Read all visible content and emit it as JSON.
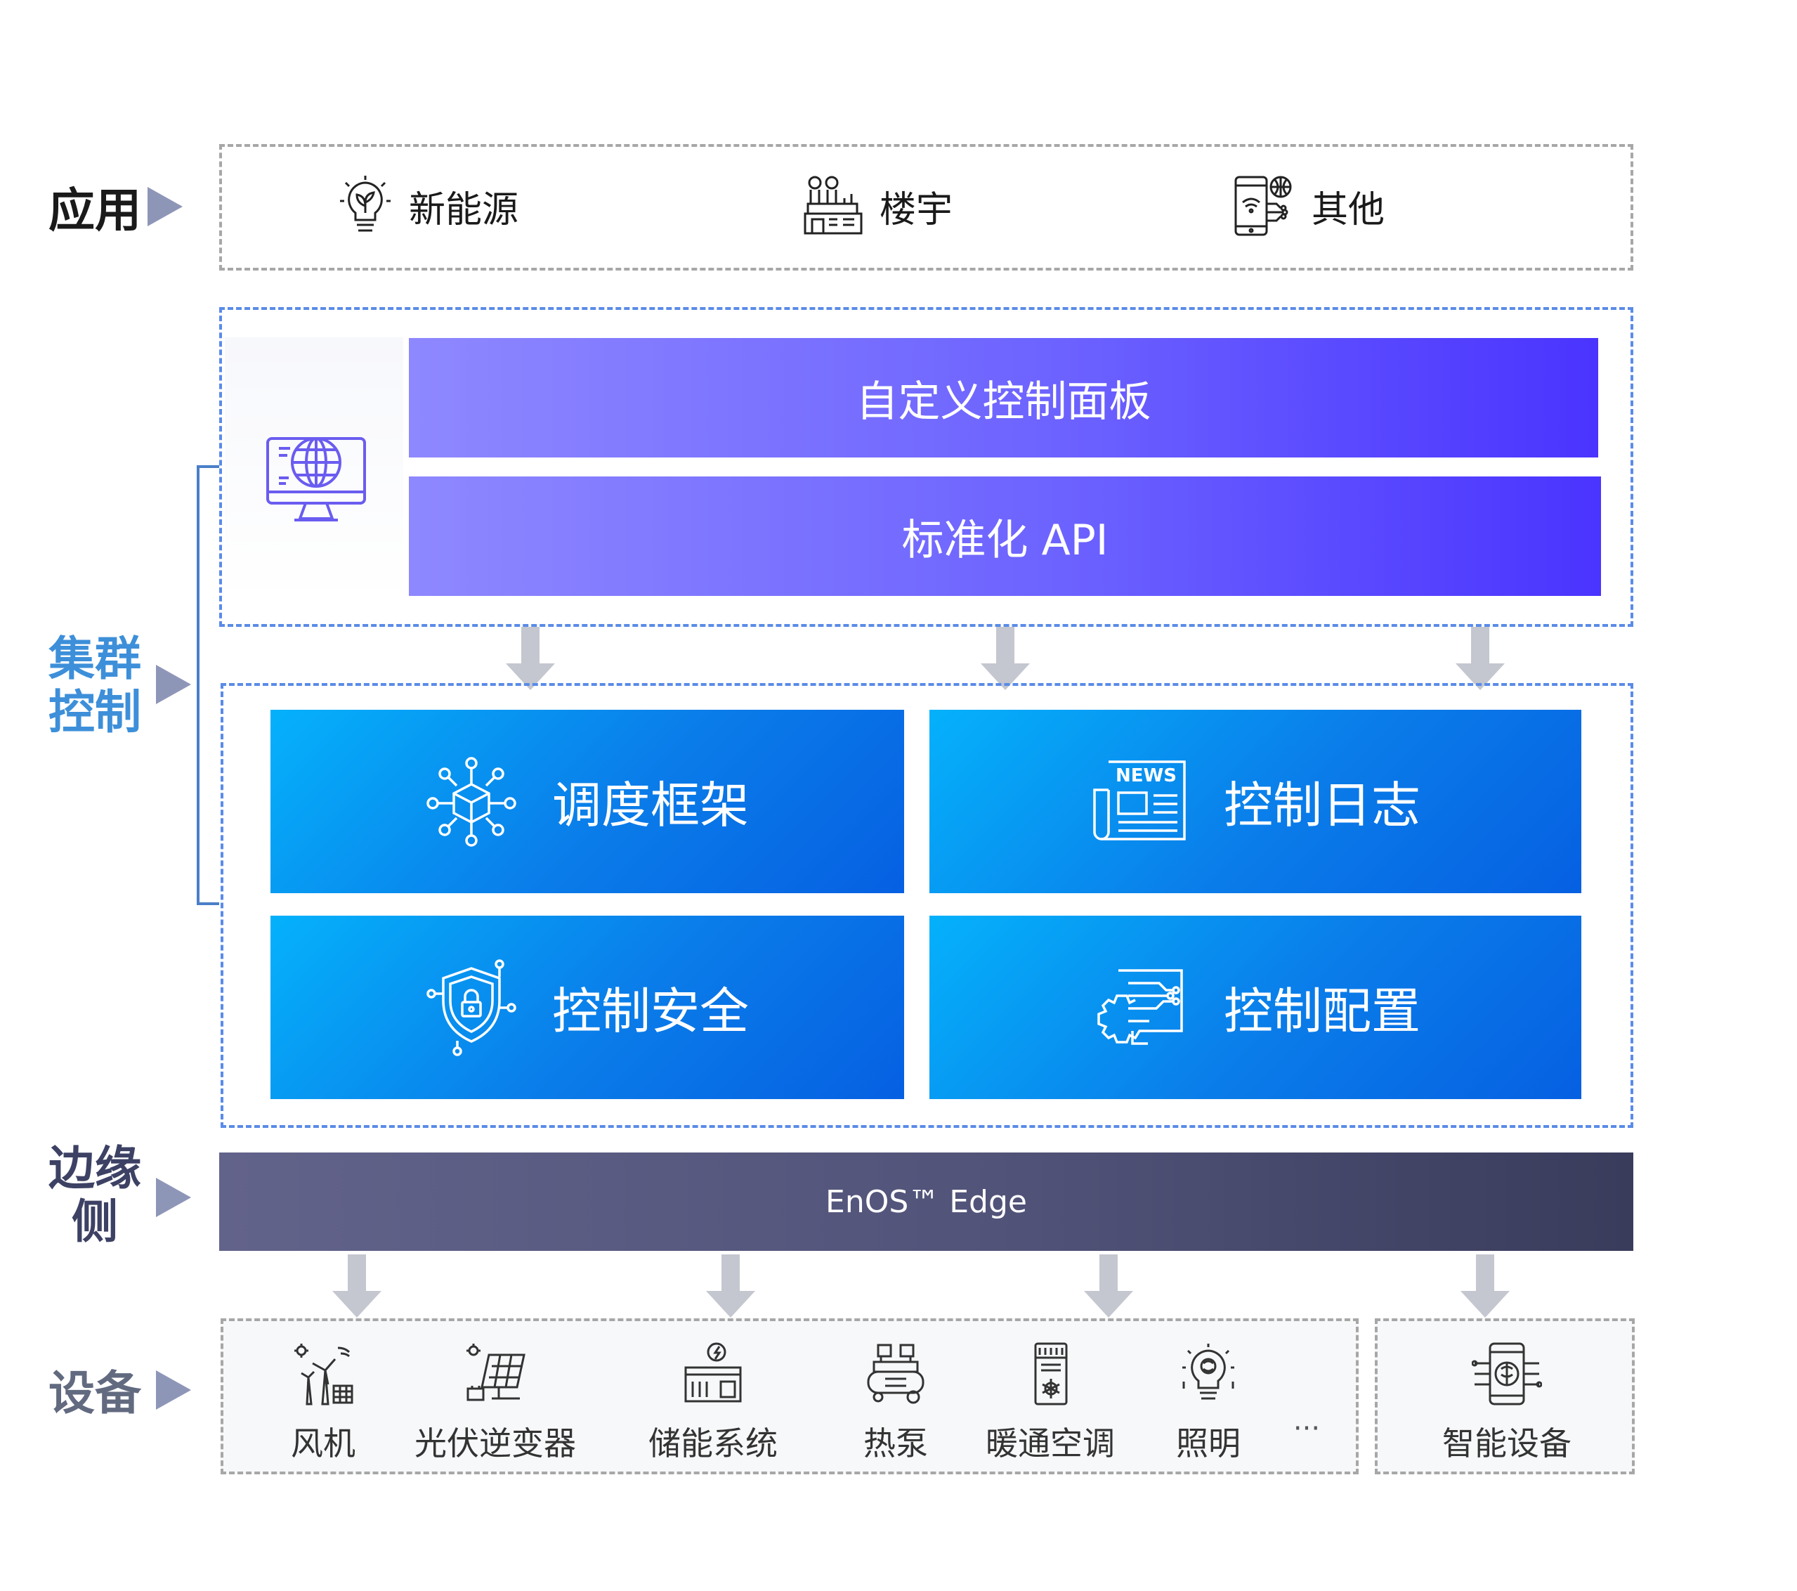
{
  "rows": {
    "app": "应用",
    "cluster": [
      "集群",
      "控制"
    ],
    "edge": [
      "边缘",
      "侧"
    ],
    "device": "设备"
  },
  "app_items": [
    {
      "label": "新能源",
      "icon": "lightbulb-leaf-icon"
    },
    {
      "label": "楼宇",
      "icon": "factory-building-icon"
    },
    {
      "label": "其他",
      "icon": "phone-network-icon"
    }
  ],
  "cluster": {
    "top_icon": "globe-monitor-icon",
    "bars": [
      "自定义控制面板",
      "标准化 API"
    ],
    "tiles": [
      {
        "label": "调度框架",
        "icon": "network-cube-icon"
      },
      {
        "label": "控制日志",
        "icon": "news-icon"
      },
      {
        "label": "控制安全",
        "icon": "shield-lock-icon"
      },
      {
        "label": "控制配置",
        "icon": "gear-circuit-icon"
      }
    ]
  },
  "edge_label": "EnOS™ Edge",
  "devices": [
    {
      "label": "风机",
      "icon": "wind-turbine-icon"
    },
    {
      "label": "光伏逆变器",
      "icon": "solar-panel-icon"
    },
    {
      "label": "储能系统",
      "icon": "energy-storage-icon"
    },
    {
      "label": "热泵",
      "icon": "heat-pump-icon"
    },
    {
      "label": "暖通空调",
      "icon": "hvac-icon"
    },
    {
      "label": "照明",
      "icon": "smart-bulb-icon"
    },
    {
      "label": "···",
      "icon": ""
    }
  ],
  "smart_device": {
    "label": "智能设备",
    "icon": "smart-device-icon"
  },
  "colors": {
    "app_label": "#1a1a1a",
    "cluster_label": "#3d8fd9",
    "edge_label": "#3d4164",
    "device_label": "#626a80",
    "purple_bar": "#6c62ff",
    "blue_tile": "#0a7ce9",
    "edge_bar": "#515379"
  }
}
